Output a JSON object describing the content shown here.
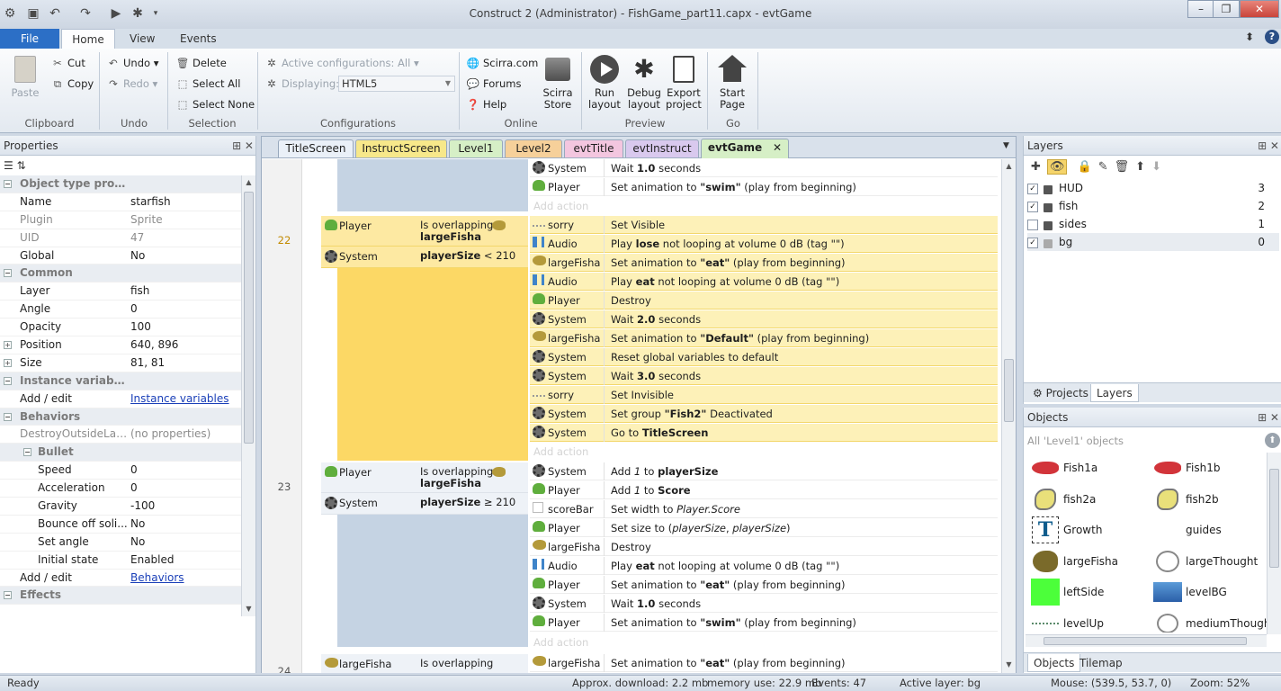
{
  "window": {
    "title": "Construct 2 (Administrator) - FishGame_part11.capx - evtGame"
  },
  "ribbon_tabs": [
    "File",
    "Home",
    "View",
    "Events"
  ],
  "ribbon": {
    "clipboard": {
      "paste": "Paste",
      "cut": "Cut",
      "copy": "Copy",
      "label": "Clipboard"
    },
    "undo": {
      "undo": "Undo",
      "redo": "Redo",
      "label": "Undo"
    },
    "selection": {
      "delete": "Delete",
      "select_all": "Select All",
      "select_none": "Select None",
      "label": "Selection"
    },
    "configurations": {
      "active": "Active configurations: All",
      "displaying_label": "Displaying:",
      "displaying_value": "HTML5",
      "label": "Configurations"
    },
    "online": {
      "scirra": "Scirra.com",
      "forums": "Forums",
      "help": "Help",
      "store": "Scirra Store",
      "label": "Online"
    },
    "preview": {
      "run": "Run layout",
      "debug": "Debug layout",
      "export": "Export project",
      "label": "Preview"
    },
    "go": {
      "start": "Start Page",
      "label": "Go"
    }
  },
  "properties": {
    "title": "Properties",
    "rows": [
      {
        "k": "Object type properties",
        "type": "sec",
        "exp": "−"
      },
      {
        "k": "Name",
        "v": "starfish"
      },
      {
        "k": "Plugin",
        "v": "Sprite",
        "dim": true
      },
      {
        "k": "UID",
        "v": "47",
        "dim": true
      },
      {
        "k": "Global",
        "v": "No"
      },
      {
        "k": "Common",
        "type": "sec",
        "exp": "−"
      },
      {
        "k": "Layer",
        "v": "fish"
      },
      {
        "k": "Angle",
        "v": "0"
      },
      {
        "k": "Opacity",
        "v": "100"
      },
      {
        "k": "Position",
        "v": "640, 896",
        "exp": "+"
      },
      {
        "k": "Size",
        "v": "81, 81",
        "exp": "+"
      },
      {
        "k": "Instance variables",
        "type": "sec",
        "exp": "−"
      },
      {
        "k": "Add / edit",
        "v": "Instance variables",
        "link": true
      },
      {
        "k": "Behaviors",
        "type": "sec",
        "exp": "−"
      },
      {
        "k": "DestroyOutsideLay...",
        "v": "(no properties)",
        "dim": true
      },
      {
        "k": "Bullet",
        "type": "sec",
        "sub": true,
        "exp": "−"
      },
      {
        "k": "Speed",
        "v": "0",
        "sub": true
      },
      {
        "k": "Acceleration",
        "v": "0",
        "sub": true
      },
      {
        "k": "Gravity",
        "v": "-100",
        "sub": true
      },
      {
        "k": "Bounce off soli...",
        "v": "No",
        "sub": true
      },
      {
        "k": "Set angle",
        "v": "No",
        "sub": true
      },
      {
        "k": "Initial state",
        "v": "Enabled",
        "sub": true
      },
      {
        "k": "Add / edit",
        "v": "Behaviors",
        "link": true
      },
      {
        "k": "Effects",
        "type": "sec",
        "exp": "−"
      }
    ]
  },
  "doc_tabs": [
    {
      "label": "TitleScreen",
      "color": "#eaf0f8"
    },
    {
      "label": "InstructScreen",
      "color": "#f7e88a"
    },
    {
      "label": "Level1",
      "color": "#d6efc6"
    },
    {
      "label": "Level2",
      "color": "#f6d09a"
    },
    {
      "label": "evtTitle",
      "color": "#f3c6df"
    },
    {
      "label": "evtInstruct",
      "color": "#d9c9ee"
    },
    {
      "label": "evtGame",
      "color": "#d6efc6",
      "active": true
    }
  ],
  "events": {
    "top": {
      "actions": [
        {
          "obj": "System",
          "icon": "gear",
          "txt": "Wait <b>1.0</b> seconds"
        },
        {
          "obj": "Player",
          "icon": "frog",
          "txt": "Set animation to <b>\"swim\"</b> (play from beginning)"
        }
      ],
      "add": "Add action"
    },
    "e22": {
      "num": "22",
      "conds": [
        {
          "obj": "Player",
          "icon": "frog",
          "txt": "Is overlapping <b>largeFisha</b>"
        },
        {
          "obj": "System",
          "icon": "gear",
          "txt": "<b>playerSize</b> &lt; 210"
        }
      ],
      "actions": [
        {
          "obj": "sorry",
          "icon": "dash",
          "txt": "Set Visible"
        },
        {
          "obj": "Audio",
          "icon": "speaker",
          "txt": "Play <b>lose</b> not looping at volume 0 dB (tag \"\")"
        },
        {
          "obj": "largeFisha",
          "icon": "fish",
          "txt": "Set animation to <b>\"eat\"</b> (play from beginning)"
        },
        {
          "obj": "Audio",
          "icon": "speaker",
          "txt": "Play <b>eat</b> not looping at volume 0 dB (tag \"\")"
        },
        {
          "obj": "Player",
          "icon": "frog",
          "txt": "Destroy"
        },
        {
          "obj": "System",
          "icon": "gear",
          "txt": "Wait <b>2.0</b> seconds"
        },
        {
          "obj": "largeFisha",
          "icon": "fish",
          "txt": "Set animation to <b>\"Default\"</b> (play from beginning)"
        },
        {
          "obj": "System",
          "icon": "gear",
          "txt": "Reset global variables to default"
        },
        {
          "obj": "System",
          "icon": "gear",
          "txt": "Wait <b>3.0</b> seconds"
        },
        {
          "obj": "sorry",
          "icon": "dash",
          "txt": "Set Invisible"
        },
        {
          "obj": "System",
          "icon": "gear",
          "txt": "Set group <b>\"Fish2\"</b> Deactivated"
        },
        {
          "obj": "System",
          "icon": "gear",
          "txt": "Go to <b>TitleScreen</b>"
        }
      ],
      "add": "Add action"
    },
    "e23": {
      "num": "23",
      "conds": [
        {
          "obj": "Player",
          "icon": "frog",
          "txt": "Is overlapping <b>largeFisha</b>"
        },
        {
          "obj": "System",
          "icon": "gear",
          "txt": "<b>playerSize</b> ≥ 210"
        }
      ],
      "actions": [
        {
          "obj": "System",
          "icon": "gear",
          "txt": "Add <i>1</i> to <b>playerSize</b>"
        },
        {
          "obj": "Player",
          "icon": "frog",
          "txt": "Add <i>1</i> to <b>Score</b>"
        },
        {
          "obj": "scoreBar",
          "icon": "box",
          "txt": "Set width to <i>Player.Score</i>"
        },
        {
          "obj": "Player",
          "icon": "frog",
          "txt": "Set size to (<i>playerSize</i>, <i>playerSize</i>)"
        },
        {
          "obj": "largeFisha",
          "icon": "fish",
          "txt": "Destroy"
        },
        {
          "obj": "Audio",
          "icon": "speaker",
          "txt": "Play <b>eat</b> not looping at volume 0 dB (tag \"\")"
        },
        {
          "obj": "Player",
          "icon": "frog",
          "txt": "Set animation to <b>\"eat\"</b> (play from beginning)"
        },
        {
          "obj": "System",
          "icon": "gear",
          "txt": "Wait <b>1.0</b> seconds"
        },
        {
          "obj": "Player",
          "icon": "frog",
          "txt": "Set animation to <b>\"swim\"</b> (play from beginning)"
        }
      ],
      "add": "Add action"
    },
    "e24": {
      "num": "24",
      "cond": {
        "obj": "largeFisha",
        "icon": "fish",
        "txt": "Is overlapping"
      },
      "action": {
        "obj": "largeFisha",
        "icon": "fish",
        "txt": "Set animation to <b>\"eat\"</b> (play from beginning)"
      }
    }
  },
  "layers": {
    "title": "Layers",
    "items": [
      {
        "name": "HUD",
        "num": "3",
        "checked": true
      },
      {
        "name": "fish",
        "num": "2",
        "checked": true
      },
      {
        "name": "sides",
        "num": "1",
        "checked": false
      },
      {
        "name": "bg",
        "num": "0",
        "checked": true
      }
    ],
    "tabs": [
      "Projects",
      "Layers"
    ]
  },
  "objects": {
    "title": "Objects",
    "filter": "All 'Level1' objects",
    "items": [
      "Fish1a",
      "Fish1b",
      "fish2a",
      "fish2b",
      "Growth",
      "guides",
      "largeFisha",
      "largeThought",
      "leftSide",
      "levelBG",
      "levelUp",
      "mediumThought"
    ],
    "tabs": [
      "Objects",
      "Tilemap"
    ]
  },
  "status": {
    "ready": "Ready",
    "download": "Approx. download: 2.2 mb",
    "memory": "memory use: 22.9 mb",
    "events": "Events: 47",
    "layer": "Active layer: bg",
    "mouse": "Mouse: (539.5, 53.7, 0)",
    "zoom": "Zoom: 52%"
  }
}
